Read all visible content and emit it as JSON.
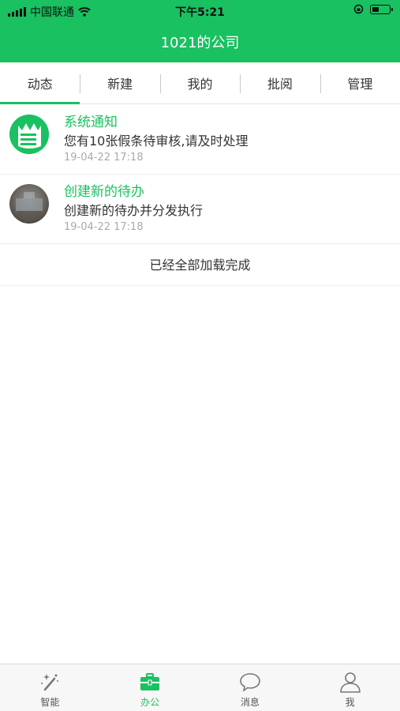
{
  "status_bar": {
    "carrier": "中国联通",
    "time": "下午5:21"
  },
  "header": {
    "title": "1021的公司"
  },
  "tabs": [
    {
      "label": "动态",
      "active": true
    },
    {
      "label": "新建",
      "active": false
    },
    {
      "label": "我的",
      "active": false
    },
    {
      "label": "批阅",
      "active": false
    },
    {
      "label": "管理",
      "active": false
    }
  ],
  "feed": [
    {
      "icon": "notification-icon",
      "title": "系统通知",
      "desc": "您有10张假条待审核,请及时处理",
      "time": "19-04-22 17:18"
    },
    {
      "icon": "photo-avatar",
      "title": "创建新的待办",
      "desc": "创建新的待办并分发执行",
      "time": "19-04-22 17:18"
    }
  ],
  "loaded_text": "已经全部加载完成",
  "bottom_nav": [
    {
      "label": "智能",
      "icon": "magic-wand-icon",
      "active": false
    },
    {
      "label": "办公",
      "icon": "briefcase-icon",
      "active": true
    },
    {
      "label": "消息",
      "icon": "chat-bubble-icon",
      "active": false
    },
    {
      "label": "我",
      "icon": "person-icon",
      "active": false
    }
  ],
  "colors": {
    "brand": "#19c160"
  }
}
